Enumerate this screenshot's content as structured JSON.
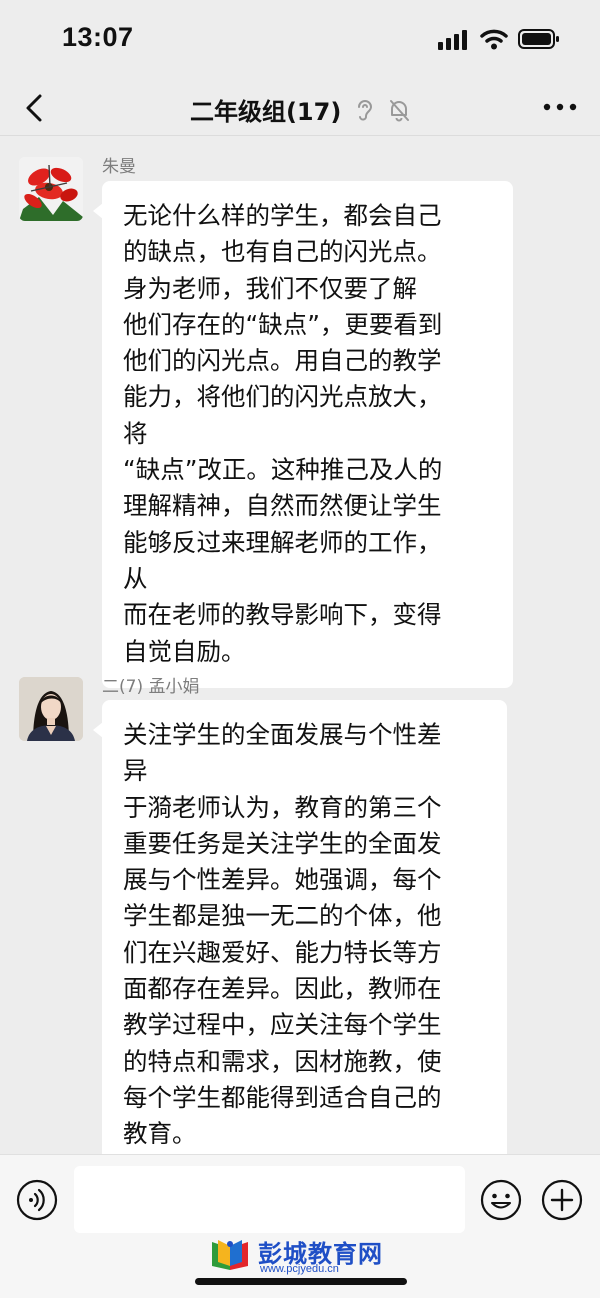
{
  "status_bar": {
    "time": "13:07"
  },
  "nav": {
    "title": "二年级组(17)"
  },
  "messages": [
    {
      "sender": "朱曼",
      "avatar": "red-flower-photo",
      "text": "无论什么样的学生，都会自己\n的缺点，也有自己的闪光点。\n身为老师，我们不仅要了解\n他们存在的“缺点”，更要看到\n他们的闪光点。用自己的教学\n能力，将他们的闪光点放大，\n将\n“缺点”改正。这种推己及人的\n理解精神，自然而然便让学生\n能够反过来理解老师的工作，\n从\n而在老师的教导影响下，变得\n自觉自励。"
    },
    {
      "sender": "二(7) 孟小娟",
      "avatar": "woman-portrait-photo",
      "text": "关注学生的全面发展与个性差\n异\n于漪老师认为，教育的第三个\n重要任务是关注学生的全面发\n展与个性差异。她强调，每个\n学生都是独一无二的个体，他\n们在兴趣爱好、能力特长等方\n面都存在差异。因此，教师在\n教学过程中，应关注每个学生\n的特点和需求，因材施教，使\n每个学生都能得到适合自己的\n教育。"
    }
  ],
  "watermark": {
    "name": "彭城教育网",
    "url": "www.pcjyedu.cn"
  },
  "icons": [
    "chevron-left-icon",
    "ear-icon",
    "bell-muted-icon",
    "more-icon",
    "voice-icon",
    "emoji-icon",
    "plus-icon"
  ],
  "colors": {
    "background": "#ededed",
    "bubble": "#ffffff",
    "sender": "#7d7d7d",
    "watermark": "#1f4fc6"
  }
}
